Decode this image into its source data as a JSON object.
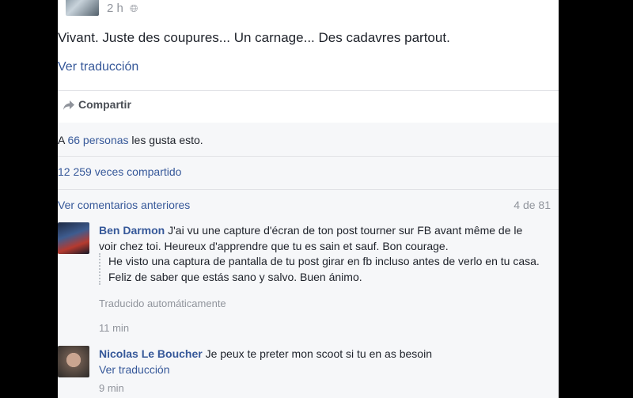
{
  "post": {
    "time": "2 h",
    "text": "Vivant. Juste des coupures... Un carnage... Des cadavres partout.",
    "translate_link": "Ver traducción",
    "share_label": "Compartir"
  },
  "stats": {
    "likes_prefix": "A",
    "likes_link": "66 personas",
    "likes_suffix": "les gusta esto.",
    "shares": "12 259 veces compartido"
  },
  "comments_header": {
    "previous": "Ver comentarios anteriores",
    "count": "4 de 81"
  },
  "comments": [
    {
      "author": "Ben Darmon",
      "text": "J'ai vu une capture d'écran de ton post tourner sur FB avant même de le voir chez toi. Heureux d'apprendre que tu es sain et sauf. Bon courage.",
      "translation": "He visto una captura de pantalla de tu post girar en fb incluso antes de verlo en tu casa. Feliz de saber que estás sano y salvo. Buen ánimo.",
      "auto_note": "Traducido automáticamente",
      "time": "11 min"
    },
    {
      "author": "Nicolas Le Boucher",
      "text": "Je peux te preter mon scoot si tu en as besoin",
      "translate_link": "Ver traducción",
      "time": "9 min"
    }
  ]
}
